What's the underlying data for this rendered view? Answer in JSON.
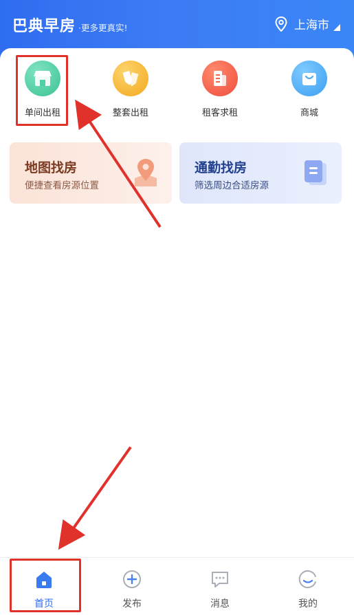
{
  "header": {
    "app_title": "巴典早房",
    "slogan": "·更多更真实!",
    "city": "上海市"
  },
  "categories": [
    {
      "label": "单间出租",
      "icon": "store-icon",
      "color": "#4fd1a5"
    },
    {
      "label": "整套出租",
      "icon": "tags-icon",
      "color": "#f7b733"
    },
    {
      "label": "租客求租",
      "icon": "document-icon",
      "color": "#f5654a"
    },
    {
      "label": "商城",
      "icon": "shopping-bag-icon",
      "color": "#4aaef5"
    }
  ],
  "promos": [
    {
      "title": "地图找房",
      "subtitle": "便捷查看房源位置",
      "icon": "map-pin-icon",
      "color": "#f29b7a"
    },
    {
      "title": "通勤找房",
      "subtitle": "筛选周边合适房源",
      "icon": "document-icon",
      "color": "#6f93ef"
    }
  ],
  "nav": [
    {
      "label": "首页",
      "icon": "home-icon",
      "active": true
    },
    {
      "label": "发布",
      "icon": "plus-circle-icon",
      "active": false
    },
    {
      "label": "消息",
      "icon": "chat-icon",
      "active": false
    },
    {
      "label": "我的",
      "icon": "smile-icon",
      "active": false
    }
  ],
  "colors": {
    "brand": "#2f6df0",
    "annotation": "#e0312b"
  }
}
